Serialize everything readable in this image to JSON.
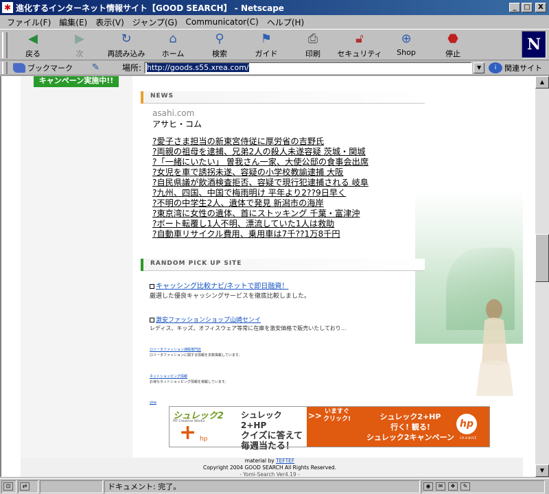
{
  "window": {
    "title": "進化するインターネット情報サイト【GOOD SEARCH】 - Netscape",
    "minimize": "_",
    "maximize": "□",
    "close": "X"
  },
  "menu": {
    "items": [
      "ファイル(F)",
      "編集(E)",
      "表示(V)",
      "ジャンプ(G)",
      "Communicator(C)",
      "ヘルプ(H)"
    ]
  },
  "toolbar": {
    "buttons": [
      {
        "label": "戻る",
        "icon": "back-arrow-icon"
      },
      {
        "label": "次",
        "icon": "forward-arrow-icon"
      },
      {
        "label": "再読み込み",
        "icon": "reload-icon"
      },
      {
        "label": "ホーム",
        "icon": "home-icon"
      },
      {
        "label": "検索",
        "icon": "search-icon"
      },
      {
        "label": "ガイド",
        "icon": "guide-icon"
      },
      {
        "label": "印刷",
        "icon": "print-icon"
      },
      {
        "label": "セキュリティ",
        "icon": "lock-icon"
      },
      {
        "label": "Shop",
        "icon": "shop-icon"
      },
      {
        "label": "停止",
        "icon": "stop-icon"
      }
    ],
    "logo": "N"
  },
  "location": {
    "bookmark_label": "ブックマーク",
    "label": "場所:",
    "url": "http://goods.s55.xrea.com/",
    "related_label": "関連サイト"
  },
  "page": {
    "campaign_label": "キャンペーン実施中!!",
    "news": {
      "header": "NEWS",
      "source": "asahi.com",
      "source_name": "アサヒ・コム",
      "items": [
        "?愛子さま担当の新東宮侍従に厚労省の吉野氏",
        "?両親の祖母を逮捕、兄弟2人の殺人未遂容疑 茨城・関城",
        "?「一緒にいたい」 曽我さん一家、大使公邸の食事会出席",
        "?女児を車で誘拐未遂、容疑の小学校教諭逮捕 大阪",
        "?自民県議が飲酒検査拒否、容疑で現行犯逮捕される 岐阜",
        "?九州、四国、中国で梅雨明け 平年より2??9日早く",
        "?不明の中学生2人、遺体で発見 新潟市の海岸",
        "?東京湾に女性の遺体、首にストッキング 千葉・富津沖",
        "?ボート転覆し1人不明、漂流していた1人は救助",
        "?自動車リサイクル費用、乗用車は7千??1万8千円"
      ]
    },
    "pickup": {
      "header": "RANDOM PICK UP SITE",
      "items": [
        {
          "title": "キャッシング比較ナビ/ネットで即日融資！",
          "desc": "厳選した優良キャッシングサービスを徹底比較しました。"
        },
        {
          "title": "激安ファッションショップ山崎センイ",
          "desc": "レディス、キッズ、オフィスウェア等常に在庫を激安価格で販売いたしており..."
        },
        {
          "title": "ロリータファッション通販専門店",
          "desc": "ロリータファッションに関する情報を多数掲載しています。"
        },
        {
          "title": "ネットショッピング情報",
          "desc": "お得なネットショッピング情報を掲載しています。"
        },
        {
          "title": "ykw",
          "desc": ""
        }
      ]
    },
    "banner": {
      "logo": "シュレック2",
      "logo_sub": "HP Creative Works",
      "plus": "+",
      "hp_small": "hp",
      "line1": "シュレック2+HP",
      "line2": "クイズに答えて",
      "line3": "毎週当たる！",
      "arrows": ">>",
      "now1": "いますぐ",
      "now2": "クリック!",
      "r1": "シュレック2+HP",
      "r2": "行く! 観る!",
      "r3": "シュレック2キャンペーン",
      "hp_logo": "hp",
      "invent": "invent"
    },
    "footer": {
      "material_prefix": "material by",
      "material_link": "TEFTEF",
      "copyright": "Copyright 2004 GOOD SEARCH All Rights Reserved.",
      "version": "- Yomi-Search Ver4.19 -"
    }
  },
  "status": {
    "text": "ドキュメント: 完了。"
  },
  "colors": {
    "title_bar": "#0a246a",
    "campaign_green": "#2a9a2a",
    "news_bar": "#e8a030",
    "pickup_bar": "#2a9a2a",
    "banner_orange": "#e05a10"
  }
}
